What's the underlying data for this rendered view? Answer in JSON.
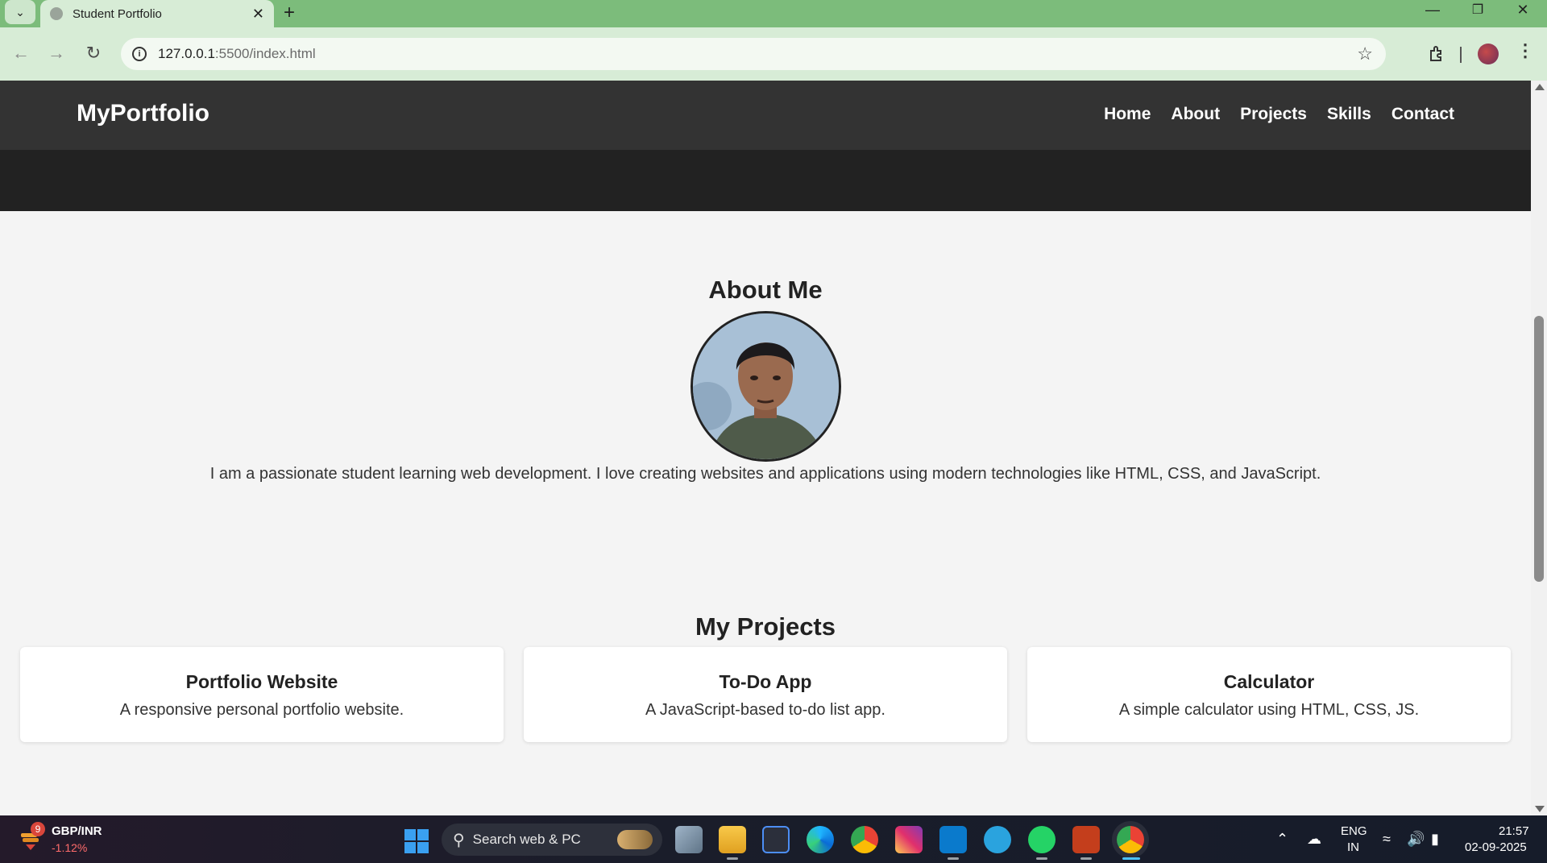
{
  "browser": {
    "tab_title": "Student Portfolio",
    "url_host": "127.0.0.1",
    "url_path": ":5500/index.html"
  },
  "site": {
    "logo": "MyPortfolio",
    "nav": [
      "Home",
      "About",
      "Projects",
      "Skills",
      "Contact"
    ]
  },
  "about": {
    "title": "About Me",
    "text": "I am a passionate student learning web development. I love creating websites and applications using modern technologies like HTML, CSS, and JavaScript."
  },
  "projects": {
    "title": "My Projects",
    "cards": [
      {
        "title": "Portfolio Website",
        "desc": "A responsive personal portfolio website."
      },
      {
        "title": "To-Do App",
        "desc": "A JavaScript-based to-do list app."
      },
      {
        "title": "Calculator",
        "desc": "A simple calculator using HTML, CSS, JS."
      }
    ]
  },
  "taskbar": {
    "widget_badge": "9",
    "widget_name": "GBP/INR",
    "widget_change": "-1.12%",
    "search_placeholder": "Search web & PC",
    "lang_top": "ENG",
    "lang_bottom": "IN",
    "time": "21:57",
    "date": "02-09-2025"
  },
  "colors": {
    "tab_strip": "#7cbc7b",
    "header_bg": "#333333",
    "hero_bg": "#222222",
    "page_bg": "#f4f4f4"
  }
}
